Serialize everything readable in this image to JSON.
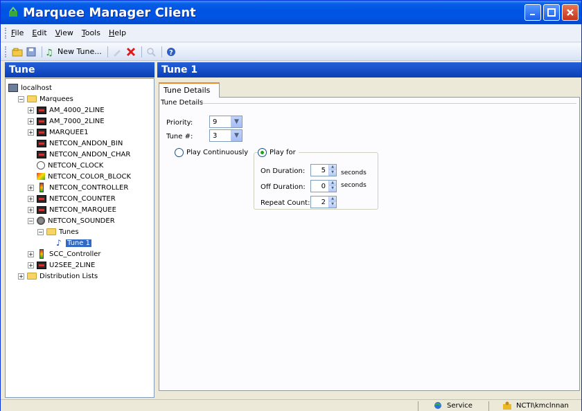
{
  "window": {
    "title": "Marquee Manager Client"
  },
  "menu": {
    "items": [
      "File",
      "Edit",
      "View",
      "Tools",
      "Help"
    ]
  },
  "toolbar": {
    "new_tune_label": "New Tune..."
  },
  "left": {
    "header": "Tune",
    "tree": [
      {
        "label": "localhost",
        "icon": "server-icon",
        "level": 0,
        "expander": ""
      },
      {
        "label": "Marquees",
        "icon": "folder-icon",
        "level": 1,
        "expander": "−"
      },
      {
        "label": "AM_4000_2LINE",
        "icon": "marquee-icon",
        "level": 2,
        "expander": "+"
      },
      {
        "label": "AM_7000_2LINE",
        "icon": "marquee-icon",
        "level": 2,
        "expander": "+"
      },
      {
        "label": "MARQUEE1",
        "icon": "marquee-icon",
        "level": 2,
        "expander": "+"
      },
      {
        "label": "NETCON_ANDON_BIN",
        "icon": "andon-icon",
        "level": 2,
        "expander": ""
      },
      {
        "label": "NETCON_ANDON_CHAR",
        "icon": "andon-icon",
        "level": 2,
        "expander": ""
      },
      {
        "label": "NETCON_CLOCK",
        "icon": "clock-icon",
        "level": 2,
        "expander": ""
      },
      {
        "label": "NETCON_COLOR_BLOCK",
        "icon": "color-block-icon",
        "level": 2,
        "expander": ""
      },
      {
        "label": "NETCON_CONTROLLER",
        "icon": "controller-icon",
        "level": 2,
        "expander": "+"
      },
      {
        "label": "NETCON_COUNTER",
        "icon": "marquee-icon",
        "level": 2,
        "expander": "+"
      },
      {
        "label": "NETCON_MARQUEE",
        "icon": "marquee-icon",
        "level": 2,
        "expander": "+"
      },
      {
        "label": "NETCON_SOUNDER",
        "icon": "sounder-icon",
        "level": 2,
        "expander": "−"
      },
      {
        "label": "Tunes",
        "icon": "folder-icon",
        "level": 3,
        "expander": "−"
      },
      {
        "label": "Tune 1",
        "icon": "note-icon",
        "level": 4,
        "expander": "",
        "selected": true
      },
      {
        "label": "SCC_Controller",
        "icon": "controller-icon",
        "level": 2,
        "expander": "+"
      },
      {
        "label": "U2SEE_2LINE",
        "icon": "marquee-icon",
        "level": 2,
        "expander": "+"
      },
      {
        "label": "Distribution Lists",
        "icon": "folder-icon",
        "level": 1,
        "expander": "+"
      }
    ]
  },
  "right": {
    "header": "Tune 1",
    "tab_label": "Tune Details",
    "group_label": "Tune Details",
    "priority": {
      "label": "Priority:",
      "value": "9"
    },
    "tune_number": {
      "label": "Tune #:",
      "value": "3"
    },
    "play_continuously": {
      "label": "Play Continuously",
      "checked": false
    },
    "play_for": {
      "label": "Play for",
      "checked": true
    },
    "on_duration": {
      "label": "On Duration:",
      "value": "5",
      "units": "seconds"
    },
    "off_duration": {
      "label": "Off Duration:",
      "value": "0",
      "units": "seconds"
    },
    "repeat_count": {
      "label": "Repeat Count:",
      "value": "2"
    }
  },
  "status": {
    "service_label": "Service",
    "user_label": "NCTI\\kmclnnan"
  },
  "colors": {
    "titlebar": "#0054e3",
    "panel_header": "#1a4fc9",
    "selection": "#316ac5",
    "tab_accent": "#e68b2c"
  }
}
